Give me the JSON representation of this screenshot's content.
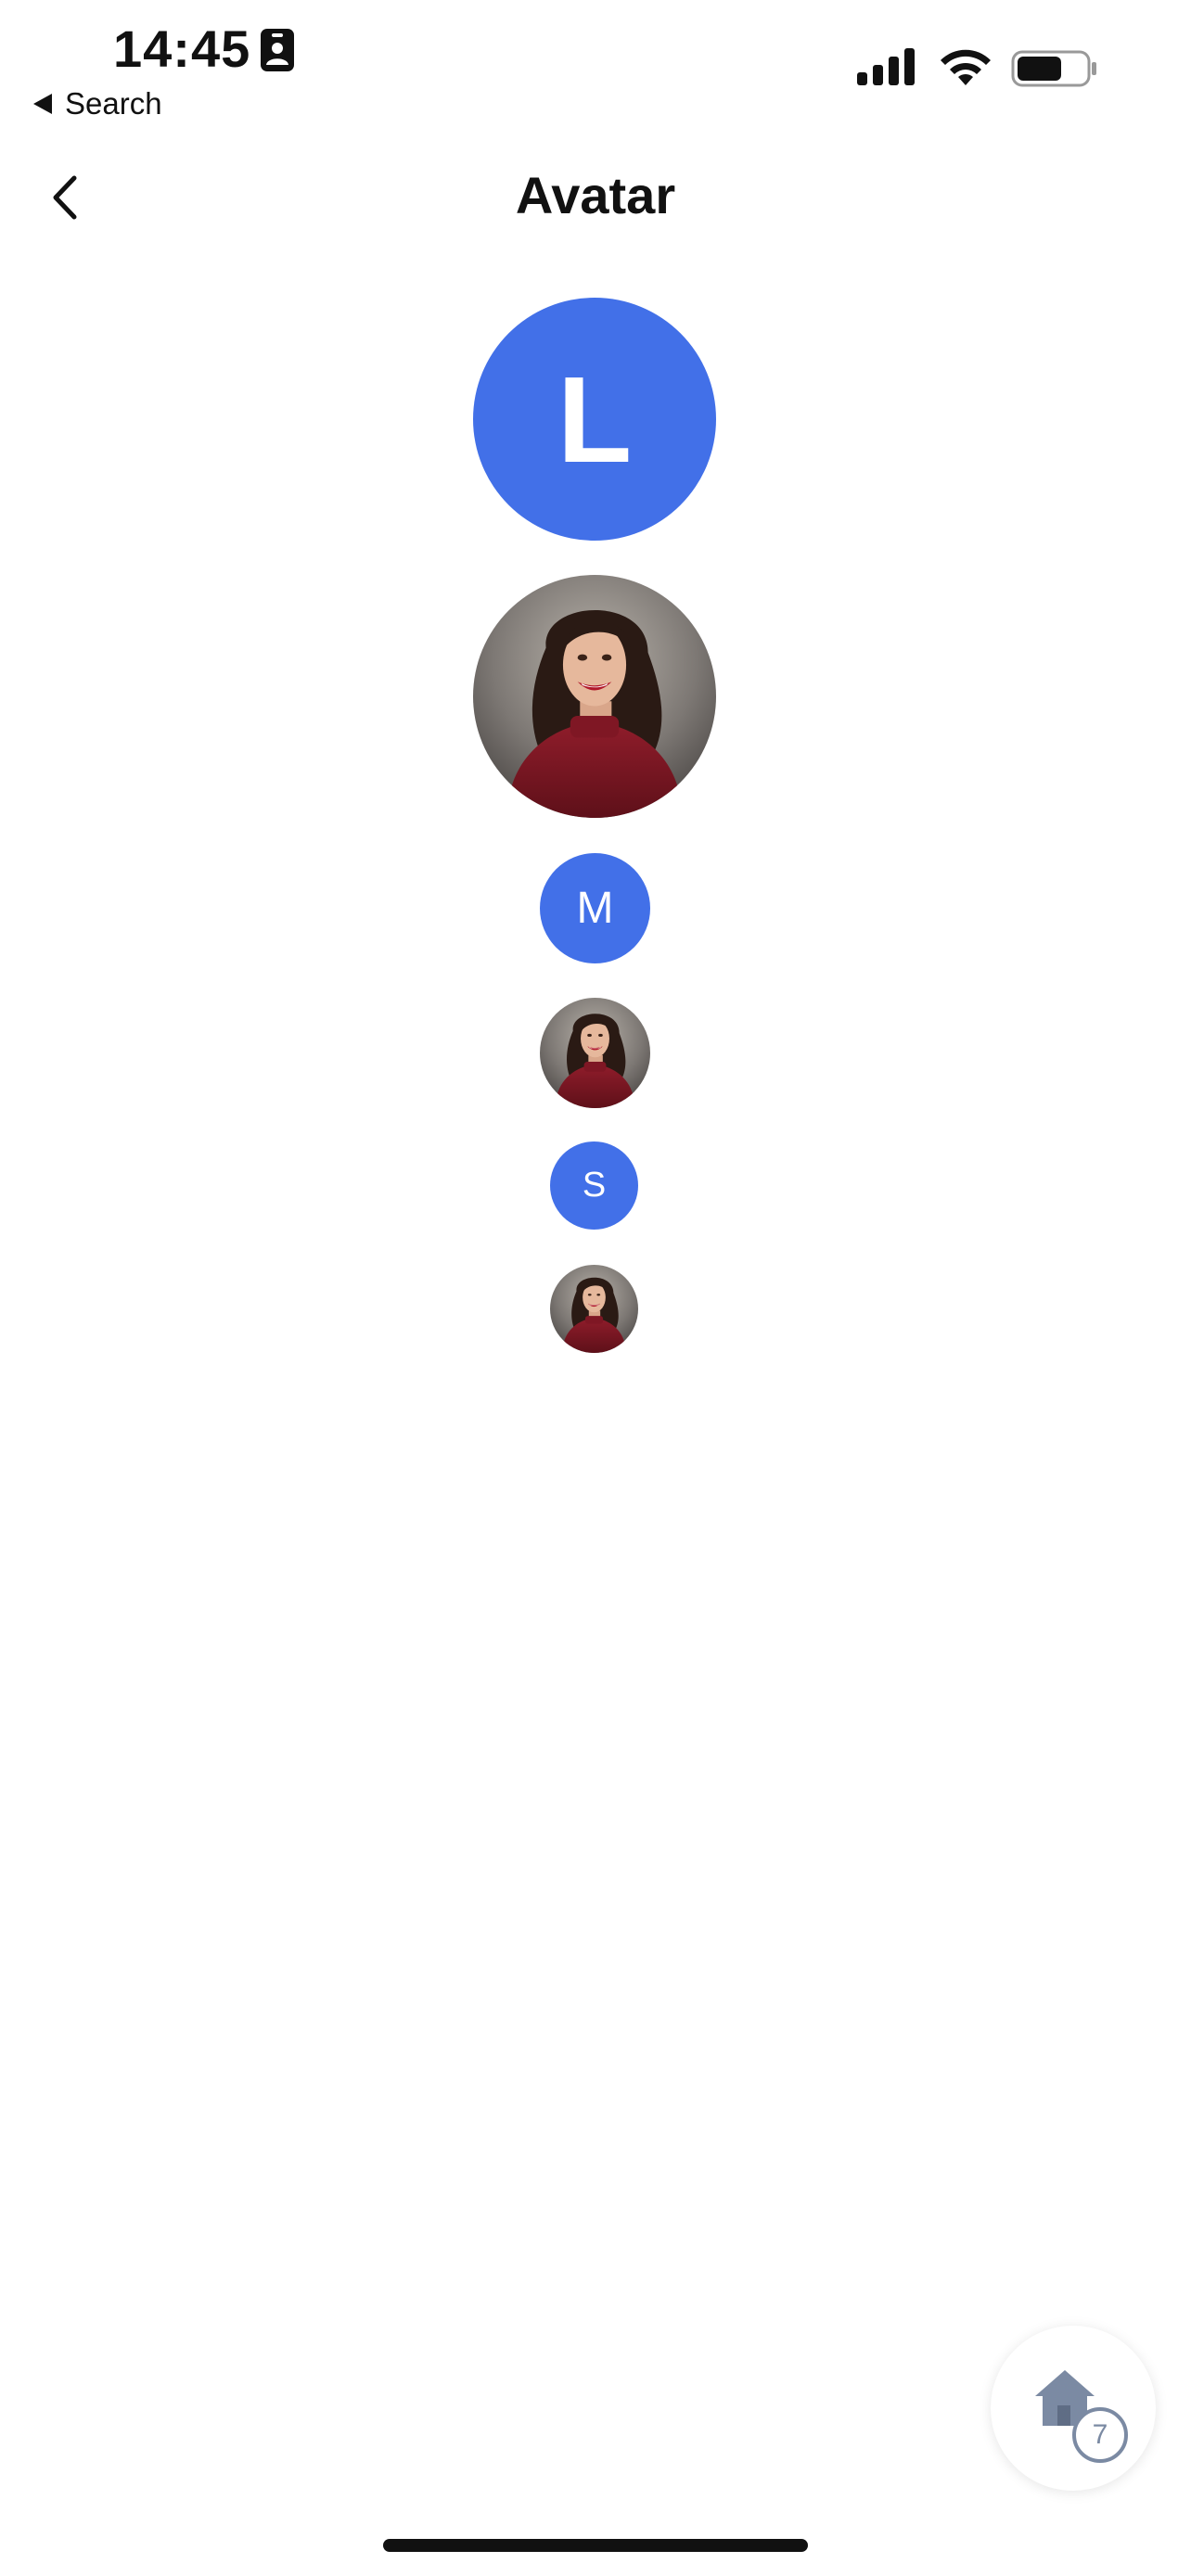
{
  "status_bar": {
    "time": "14:45",
    "back_app_label": "Search",
    "battery_level": 0.65
  },
  "nav": {
    "title": "Avatar",
    "back_icon": "chevron-left-icon"
  },
  "avatars": [
    {
      "kind": "initial",
      "size": "large",
      "letter": "L"
    },
    {
      "kind": "photo",
      "size": "large",
      "subject": "smiling woman in red sweater"
    },
    {
      "kind": "initial",
      "size": "medium",
      "letter": "M"
    },
    {
      "kind": "photo",
      "size": "medium",
      "subject": "smiling woman in red sweater"
    },
    {
      "kind": "initial",
      "size": "small",
      "letter": "S"
    },
    {
      "kind": "photo",
      "size": "small",
      "subject": "smiling woman in red sweater"
    }
  ],
  "colors": {
    "avatar_background": "#4270e8",
    "avatar_text": "#ffffff",
    "home_icon": "#7b8aa3"
  },
  "home_button": {
    "icon": "home-icon",
    "badge_count": "7"
  }
}
